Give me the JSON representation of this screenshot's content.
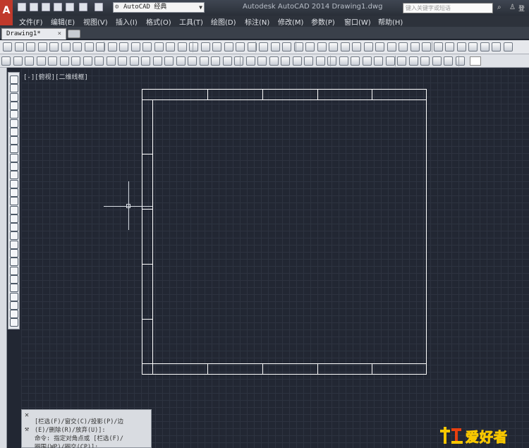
{
  "titlebar": {
    "workspace": "AutoCAD 经典",
    "title": "Autodesk AutoCAD 2014    Drawing1.dwg",
    "search_placeholder": "键入关键字或短语",
    "signin_label": "登"
  },
  "menubar": {
    "items": [
      {
        "label": "文件(F)"
      },
      {
        "label": "编辑(E)"
      },
      {
        "label": "视图(V)"
      },
      {
        "label": "插入(I)"
      },
      {
        "label": "格式(O)"
      },
      {
        "label": "工具(T)"
      },
      {
        "label": "绘图(D)"
      },
      {
        "label": "标注(N)"
      },
      {
        "label": "修改(M)"
      },
      {
        "label": "参数(P)"
      },
      {
        "label": "窗口(W)"
      },
      {
        "label": "帮助(H)"
      }
    ]
  },
  "tabs": {
    "active_document": "Drawing1*",
    "close_glyph": "×"
  },
  "viewport": {
    "label": "[-][俯视][二维线框]"
  },
  "command_line": {
    "lines": [
      "[栏选(F)/窗交(C)/投影(P)/边",
      "(E)/删除(R)/放弃(U)]:",
      "命令: 指定对角点或 [栏选(F)/",
      "圈围(WP)/圈交(CP)]:"
    ]
  },
  "watermark": {
    "text": "爱好者"
  },
  "colors": {
    "canvas_bg": "#222733",
    "grid": "#2d3340",
    "drawing_lines": "#ffffff",
    "accent_red": "#c0392b"
  }
}
